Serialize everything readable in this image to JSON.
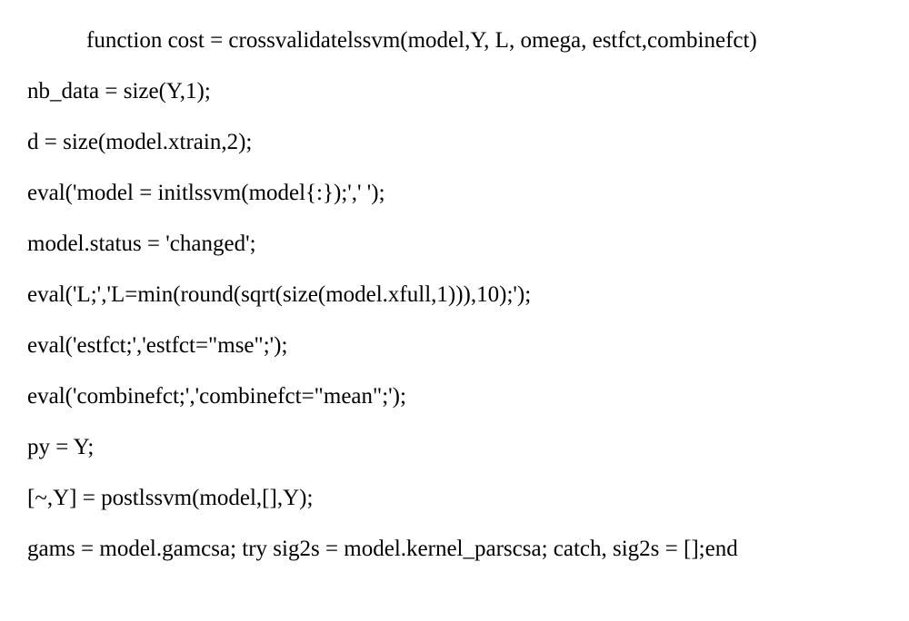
{
  "code": {
    "l0": "function cost = crossvalidatelssvm(model,Y, L, omega, estfct,combinefct)",
    "l1": "nb_data = size(Y,1);",
    "l2": "d = size(model.xtrain,2);",
    "l3": "eval('model = initlssvm(model{:});',' ');",
    "l4": "model.status = 'changed';",
    "l5": "eval('L;','L=min(round(sqrt(size(model.xfull,1))),10);');",
    "l6": "eval('estfct;','estfct=\"mse\";');",
    "l7": "eval('combinefct;','combinefct=\"mean\";');",
    "l8": "py = Y;",
    "l9": "[~,Y] = postlssvm(model,[],Y);",
    "l10": "gams = model.gamcsa; try sig2s = model.kernel_parscsa; catch, sig2s = [];end"
  }
}
